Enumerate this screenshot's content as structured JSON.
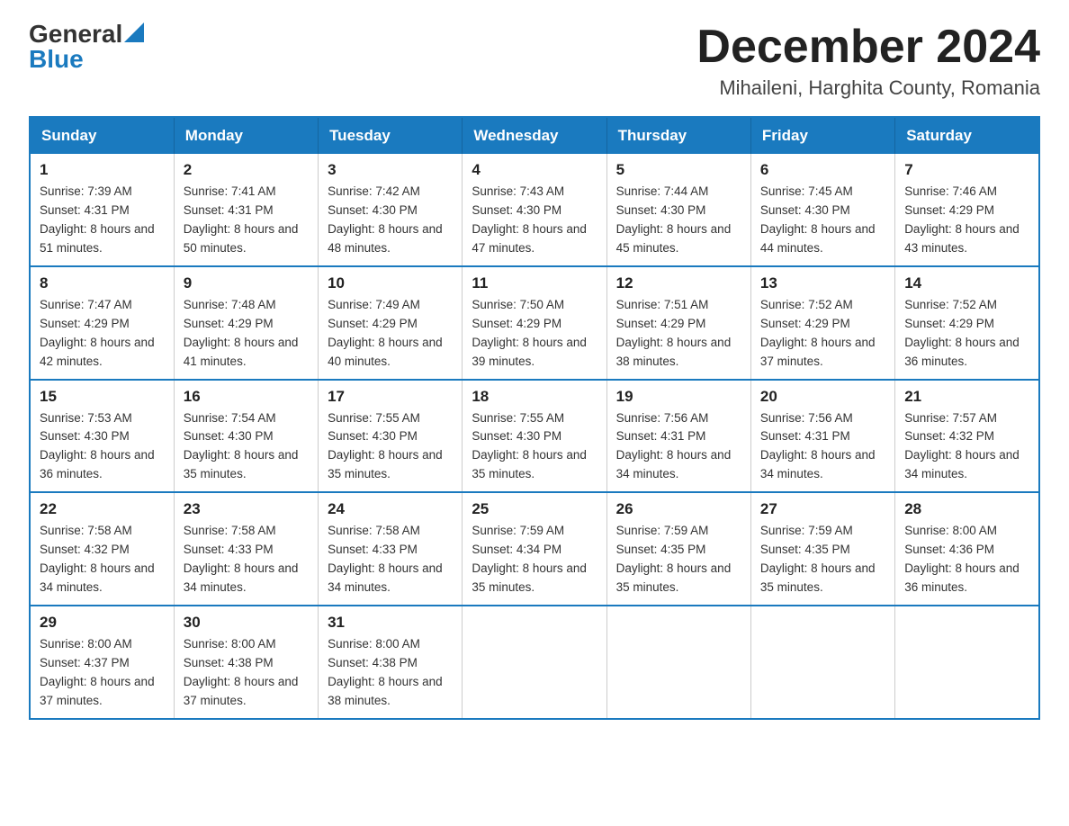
{
  "logo": {
    "general": "General",
    "blue": "Blue",
    "triangle": "▲"
  },
  "title": "December 2024",
  "location": "Mihaileni, Harghita County, Romania",
  "days_of_week": [
    "Sunday",
    "Monday",
    "Tuesday",
    "Wednesday",
    "Thursday",
    "Friday",
    "Saturday"
  ],
  "weeks": [
    [
      {
        "day": "1",
        "sunrise": "7:39 AM",
        "sunset": "4:31 PM",
        "daylight": "8 hours and 51 minutes."
      },
      {
        "day": "2",
        "sunrise": "7:41 AM",
        "sunset": "4:31 PM",
        "daylight": "8 hours and 50 minutes."
      },
      {
        "day": "3",
        "sunrise": "7:42 AM",
        "sunset": "4:30 PM",
        "daylight": "8 hours and 48 minutes."
      },
      {
        "day": "4",
        "sunrise": "7:43 AM",
        "sunset": "4:30 PM",
        "daylight": "8 hours and 47 minutes."
      },
      {
        "day": "5",
        "sunrise": "7:44 AM",
        "sunset": "4:30 PM",
        "daylight": "8 hours and 45 minutes."
      },
      {
        "day": "6",
        "sunrise": "7:45 AM",
        "sunset": "4:30 PM",
        "daylight": "8 hours and 44 minutes."
      },
      {
        "day": "7",
        "sunrise": "7:46 AM",
        "sunset": "4:29 PM",
        "daylight": "8 hours and 43 minutes."
      }
    ],
    [
      {
        "day": "8",
        "sunrise": "7:47 AM",
        "sunset": "4:29 PM",
        "daylight": "8 hours and 42 minutes."
      },
      {
        "day": "9",
        "sunrise": "7:48 AM",
        "sunset": "4:29 PM",
        "daylight": "8 hours and 41 minutes."
      },
      {
        "day": "10",
        "sunrise": "7:49 AM",
        "sunset": "4:29 PM",
        "daylight": "8 hours and 40 minutes."
      },
      {
        "day": "11",
        "sunrise": "7:50 AM",
        "sunset": "4:29 PM",
        "daylight": "8 hours and 39 minutes."
      },
      {
        "day": "12",
        "sunrise": "7:51 AM",
        "sunset": "4:29 PM",
        "daylight": "8 hours and 38 minutes."
      },
      {
        "day": "13",
        "sunrise": "7:52 AM",
        "sunset": "4:29 PM",
        "daylight": "8 hours and 37 minutes."
      },
      {
        "day": "14",
        "sunrise": "7:52 AM",
        "sunset": "4:29 PM",
        "daylight": "8 hours and 36 minutes."
      }
    ],
    [
      {
        "day": "15",
        "sunrise": "7:53 AM",
        "sunset": "4:30 PM",
        "daylight": "8 hours and 36 minutes."
      },
      {
        "day": "16",
        "sunrise": "7:54 AM",
        "sunset": "4:30 PM",
        "daylight": "8 hours and 35 minutes."
      },
      {
        "day": "17",
        "sunrise": "7:55 AM",
        "sunset": "4:30 PM",
        "daylight": "8 hours and 35 minutes."
      },
      {
        "day": "18",
        "sunrise": "7:55 AM",
        "sunset": "4:30 PM",
        "daylight": "8 hours and 35 minutes."
      },
      {
        "day": "19",
        "sunrise": "7:56 AM",
        "sunset": "4:31 PM",
        "daylight": "8 hours and 34 minutes."
      },
      {
        "day": "20",
        "sunrise": "7:56 AM",
        "sunset": "4:31 PM",
        "daylight": "8 hours and 34 minutes."
      },
      {
        "day": "21",
        "sunrise": "7:57 AM",
        "sunset": "4:32 PM",
        "daylight": "8 hours and 34 minutes."
      }
    ],
    [
      {
        "day": "22",
        "sunrise": "7:58 AM",
        "sunset": "4:32 PM",
        "daylight": "8 hours and 34 minutes."
      },
      {
        "day": "23",
        "sunrise": "7:58 AM",
        "sunset": "4:33 PM",
        "daylight": "8 hours and 34 minutes."
      },
      {
        "day": "24",
        "sunrise": "7:58 AM",
        "sunset": "4:33 PM",
        "daylight": "8 hours and 34 minutes."
      },
      {
        "day": "25",
        "sunrise": "7:59 AM",
        "sunset": "4:34 PM",
        "daylight": "8 hours and 35 minutes."
      },
      {
        "day": "26",
        "sunrise": "7:59 AM",
        "sunset": "4:35 PM",
        "daylight": "8 hours and 35 minutes."
      },
      {
        "day": "27",
        "sunrise": "7:59 AM",
        "sunset": "4:35 PM",
        "daylight": "8 hours and 35 minutes."
      },
      {
        "day": "28",
        "sunrise": "8:00 AM",
        "sunset": "4:36 PM",
        "daylight": "8 hours and 36 minutes."
      }
    ],
    [
      {
        "day": "29",
        "sunrise": "8:00 AM",
        "sunset": "4:37 PM",
        "daylight": "8 hours and 37 minutes."
      },
      {
        "day": "30",
        "sunrise": "8:00 AM",
        "sunset": "4:38 PM",
        "daylight": "8 hours and 37 minutes."
      },
      {
        "day": "31",
        "sunrise": "8:00 AM",
        "sunset": "4:38 PM",
        "daylight": "8 hours and 38 minutes."
      },
      null,
      null,
      null,
      null
    ]
  ],
  "labels": {
    "sunrise": "Sunrise:",
    "sunset": "Sunset:",
    "daylight": "Daylight:"
  }
}
